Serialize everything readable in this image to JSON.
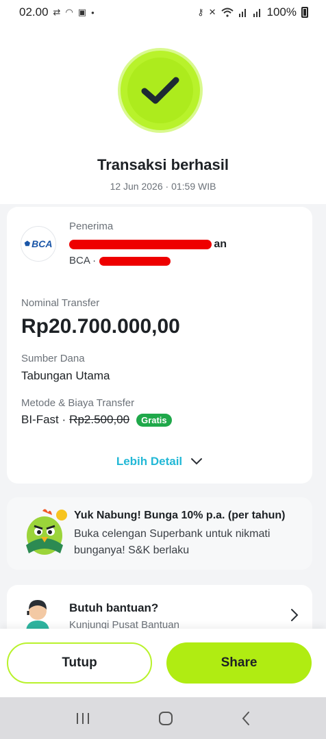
{
  "status_bar": {
    "time": "02.00",
    "left_icons": [
      "sync-icon",
      "headset-icon",
      "bri-app-icon",
      "dot-icon"
    ],
    "right_icons": [
      "key-icon",
      "mute-icon",
      "wifi-icon",
      "signal-icon",
      "signal-icon"
    ],
    "battery": "100%"
  },
  "result": {
    "title": "Transaksi berhasil",
    "datetime": "12 Jun 2026 · 01:59 WIB"
  },
  "recipient": {
    "label": "Penerima",
    "bank_logo": "BCA",
    "name_tail": "an",
    "bank_prefix": "BCA ·"
  },
  "transfer": {
    "nominal_label": "Nominal Transfer",
    "nominal_value": "Rp20.700.000,00",
    "source_label": "Sumber Dana",
    "source_value": "Tabungan Utama",
    "method_label": "Metode & Biaya Transfer",
    "method_name": "BI-Fast ·",
    "fee_original": "Rp2.500,00",
    "fee_badge": "Gratis",
    "more_detail": "Lebih Detail"
  },
  "promo": {
    "title": "Yuk Nabung! Bunga 10% p.a. (per tahun)",
    "body": "Buka celengan Superbank untuk nikmati bunganya! S&K berlaku"
  },
  "help": {
    "title": "Butuh bantuan?",
    "subtitle": "Kunjungi Pusat Bantuan"
  },
  "actions": {
    "close_label": "Tutup",
    "share_label": "Share"
  },
  "colors": {
    "accent": "#b0ec12",
    "link": "#22b8d6",
    "free_badge": "#1fa84a",
    "redaction": "#ee0000"
  }
}
